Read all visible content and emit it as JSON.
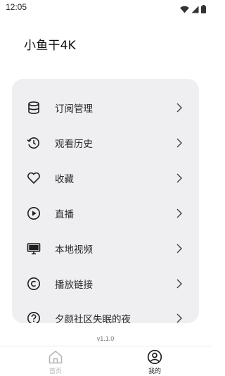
{
  "status_bar": {
    "time": "12:05",
    "icons": [
      "wifi-icon",
      "cellular-icon",
      "battery-icon"
    ]
  },
  "app_title": "小鱼干4K",
  "menu": {
    "items": [
      {
        "label": "订阅管理",
        "icon": "database-icon"
      },
      {
        "label": "观看历史",
        "icon": "history-icon"
      },
      {
        "label": "收藏",
        "icon": "heart-icon"
      },
      {
        "label": "直播",
        "icon": "play-circle-icon"
      },
      {
        "label": "本地视频",
        "icon": "monitor-icon"
      },
      {
        "label": "播放链接",
        "icon": "copyright-icon"
      },
      {
        "label": "夕颜社区失眠的夜",
        "icon": "help-circle-icon"
      }
    ]
  },
  "version": "v1.1.0",
  "bottom_nav": {
    "home_label": "首页",
    "mine_label": "我的",
    "active": "mine",
    "active_color": "#1f1f1f",
    "inactive_color": "#b5b5b5"
  }
}
